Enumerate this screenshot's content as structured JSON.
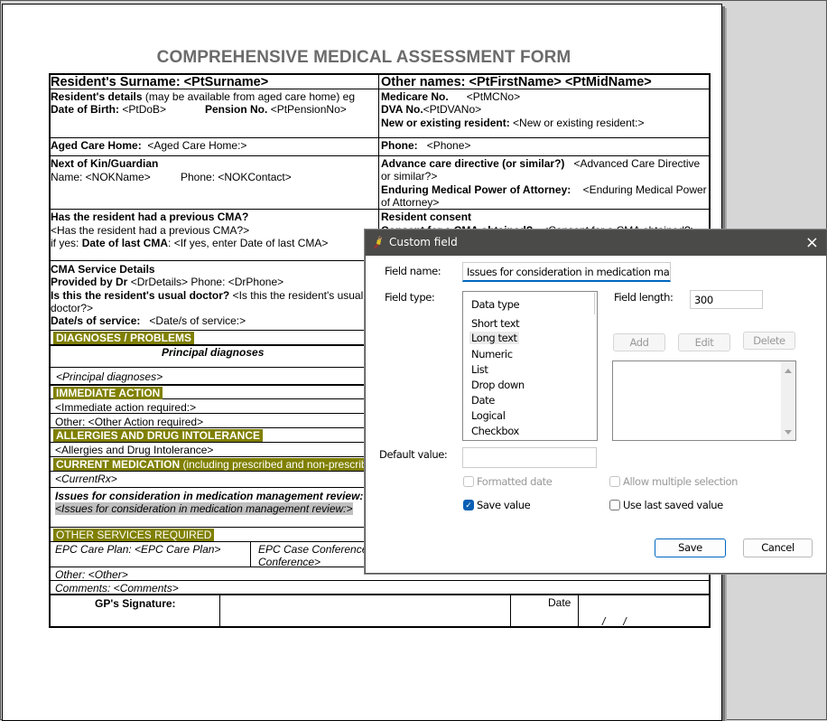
{
  "document": {
    "title": "COMPREHENSIVE MEDICAL ASSESSMENT FORM",
    "surname_row": "Resident's Surname: <PtSurname>",
    "other_names_row": "Other names: <PtFirstName> <PtMidName>",
    "residents_details_label": "Resident's details",
    "residents_details_note": " (may be available from aged care home) eg",
    "dob_label": "Date of Birth:",
    "dob_value": "<PtDoB>",
    "pension_label": "Pension No.",
    "pension_value": "<PtPensionNo>",
    "medicare_label": "Medicare No.",
    "medicare_value": "<PtMCNo>",
    "dva_label": "DVA No.",
    "dva_value": "<PtDVANo>",
    "new_existing_label": "New or existing resident:",
    "new_existing_value": "<New or existing resident:>",
    "aged_care_label": "Aged Care Home:",
    "aged_care_value": "<Aged Care Home:>",
    "phone_label": "Phone:",
    "phone_value": "<Phone>",
    "nok_heading": "Next of Kin/Guardian",
    "nok_name": "Name: <NOKName>",
    "nok_phone": "Phone: <NOKContact>",
    "acd_label": "Advance care directive (or similar?)",
    "acd_value_1": "<Advanced Care Directive",
    "acd_value_2": "or similar?>",
    "empa_label": "Enduring Medical Power of Attorney:",
    "empa_value_1": "<Enduring Medical Power",
    "empa_value_2": "of Attorney>",
    "prev_cma_heading": "Has the resident had a previous CMA?",
    "prev_cma_value": "<Has the resident had a previous CMA?>",
    "if_yes": " if yes:",
    "date_last_cma_label": "Date of last CMA",
    "date_last_cma_value": ": <If yes, enter Date of last CMA>",
    "resident_consent": "Resident consent",
    "consent_label": "Consent for a CMA obtained?",
    "consent_value": "<Consent for a CMA obtained?>",
    "cma_service_heading": "CMA Service Details",
    "provided_by_label": "Provided by Dr",
    "provided_by_value": " <DrDetails> Phone: <DrPhone>",
    "usual_doctor_label": "Is this the resident's usual doctor?",
    "usual_doctor_value_1": " <Is this the resident's usual",
    "usual_doctor_value_2": "doctor?>",
    "date_service_label": "Date/s of service:",
    "date_service_value": "<Date/s of service:>",
    "diagnoses_heading": "DIAGNOSES / PROBLEMS",
    "principal_diagnoses_heading": "Principal diagnoses",
    "principal_diagnoses_value": "<Principal diagnoses>",
    "immediate_action_heading": "IMMEDIATE ACTION",
    "immediate_action_value": "<Immediate action required:>",
    "other_action": "Other:  <Other Action required>",
    "allergies_heading": "ALLERGIES AND DRUG INTOLERANCE",
    "allergies_value": "<Allergies and Drug Intolerance>",
    "current_med_heading": "CURRENT MEDICATION",
    "current_med_note": " (including prescribed and non-prescrib",
    "current_rx": "<CurrentRx>",
    "issues_heading": "Issues for consideration in medication management review:",
    "issues_value": "<Issues for consideration in medication management review:>",
    "other_services_heading": "OTHER SERVICES REQUIRED",
    "epc_care_plan": "EPC Care Plan:  <EPC Care Plan>",
    "epc_case_conf_1": "EPC Case Conference",
    "epc_case_conf_2": "Conference>",
    "other": "Other:  <Other>",
    "comments": "Comments: <Comments>",
    "gp_signature": "GP's Signature:",
    "date_label": "Date",
    "date_slashes": "/      /"
  },
  "dialog": {
    "title": "Custom field",
    "close_icon": "×",
    "field_name_label": "Field name:",
    "field_name_value": "Issues for consideration in medication managem",
    "field_type_label": "Field type:",
    "field_types": [
      "Data type",
      "Short text",
      "Long text",
      "Numeric",
      "List",
      "Drop down",
      "Date",
      "Logical",
      "Checkbox"
    ],
    "selected_field_type": "Long text",
    "field_length_label": "Field length:",
    "field_length_value": "300",
    "add_label": "Add",
    "edit_label": "Edit",
    "delete_label": "Delete",
    "default_value_label": "Default value:",
    "default_value": "",
    "formatted_date_label": "Formatted date",
    "formatted_date_checked": false,
    "allow_multiple_label": "Allow multiple selection",
    "allow_multiple_checked": false,
    "save_value_label": "Save value",
    "save_value_checked": true,
    "use_last_saved_label": "Use last saved value",
    "use_last_saved_checked": false,
    "save_button": "Save",
    "cancel_button": "Cancel",
    "accent_color": "#0a5fb4"
  }
}
